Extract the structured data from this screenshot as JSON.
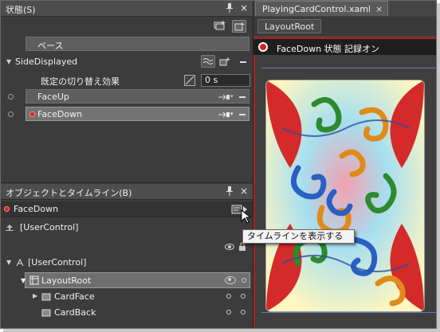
{
  "states_panel": {
    "title": "状態(S)",
    "base_label": "ベース",
    "group": {
      "name": "SideDisplayed",
      "default_transition_label": "既定の切り替え効果",
      "duration": "0 s",
      "states": [
        {
          "name": "FaceUp",
          "recording": false,
          "selected": false
        },
        {
          "name": "FaceDown",
          "recording": true,
          "selected": true
        }
      ]
    }
  },
  "objects_panel": {
    "title": "オブジェクトとタイムライン(B)",
    "timeline_name": "FaceDown",
    "tooltip": "タイムラインを表示する",
    "tree": [
      {
        "label": "[UserControl]",
        "level": 0,
        "kind": "root-top"
      },
      {
        "label": "[UserControl]",
        "level": 0,
        "kind": "root"
      },
      {
        "label": "LayoutRoot",
        "level": 1,
        "kind": "grid",
        "selected": true
      },
      {
        "label": "CardFace",
        "level": 2,
        "kind": "element"
      },
      {
        "label": "CardBack",
        "level": 2,
        "kind": "element"
      }
    ]
  },
  "document": {
    "tab_label": "PlayingCardControl.xaml",
    "tab_close": "×",
    "breadcrumb": "LayoutRoot",
    "recording_text": "FaceDown 状態 記録オン"
  },
  "colors": {
    "record_red": "#d62020",
    "panel_bg": "#3c3c3c",
    "selection": "#6f6f6f",
    "artboard_guide": "#5b7fc4"
  },
  "icons": [
    "pin-icon",
    "close-icon",
    "add-state-group-icon",
    "add-state-icon",
    "transition-icon",
    "add-transition-icon",
    "remove-icon",
    "easing-icon",
    "timeline-icon",
    "eye-icon",
    "lock-icon",
    "grid-icon",
    "usercontrol-icon"
  ]
}
